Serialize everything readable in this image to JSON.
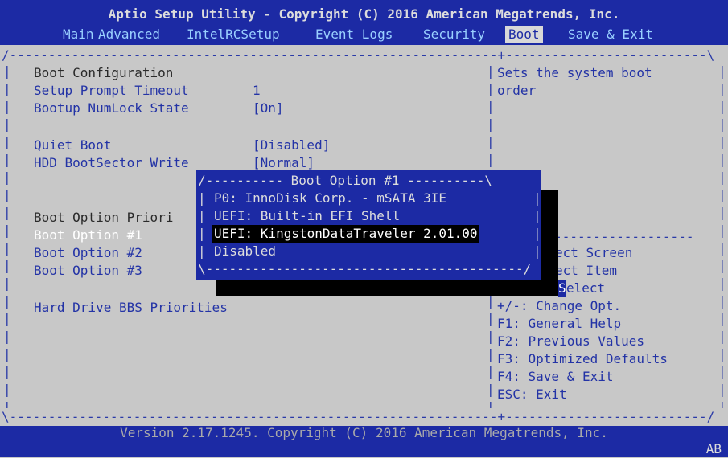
{
  "header": {
    "title": "Aptio Setup Utility - Copyright (C) 2016 American Megatrends, Inc.",
    "tabs": [
      "Main",
      "Advanced",
      "IntelRCSetup",
      "Event Logs",
      "Security",
      "Boot",
      "Save & Exit"
    ],
    "active_tab": "Boot"
  },
  "left": {
    "heading_boot_config": "Boot Configuration",
    "setup_prompt_label": "Setup Prompt Timeout",
    "setup_prompt_value": "1",
    "numlock_label": "Bootup NumLock State",
    "numlock_value": "[On]",
    "quiet_boot_label": "Quiet Boot",
    "quiet_boot_value": "[Disabled]",
    "hdd_label": "HDD BootSector Write",
    "hdd_value": "[Normal]",
    "priorities_heading": "Boot Option Priori",
    "boot1": "Boot Option #1",
    "boot2": "Boot Option #2",
    "boot3": "Boot Option #3",
    "hdd_bbs": "Hard Drive BBS Priorities"
  },
  "help": {
    "line1": "Sets the system boot",
    "line2": "order"
  },
  "keys": {
    "k1": "ect Screen",
    "k2": "ect Item",
    "k3_hl": "S",
    "k3": "elect",
    "k4": "+/-: Change Opt.",
    "k5": "F1: General Help",
    "k6": "F2: Previous Values",
    "k7": "F3: Optimized Defaults",
    "k8": "F4: Save & Exit",
    "k9": "ESC: Exit"
  },
  "popup": {
    "title": "Boot Option #1",
    "options": [
      "P0: InnoDisk Corp. - mSATA 3IE",
      "UEFI: Built-in EFI Shell",
      "UEFI: KingstonDataTraveler 2.01.00",
      "Disabled"
    ],
    "selected_index": 2
  },
  "footer": {
    "version": "Version 2.17.1245. Copyright (C) 2016 American Megatrends, Inc.",
    "corner": "AB"
  },
  "colors": {
    "bios_blue": "#1c2aa4",
    "panel_gray": "#c8c8c8",
    "text_blue": "#2333a6"
  }
}
